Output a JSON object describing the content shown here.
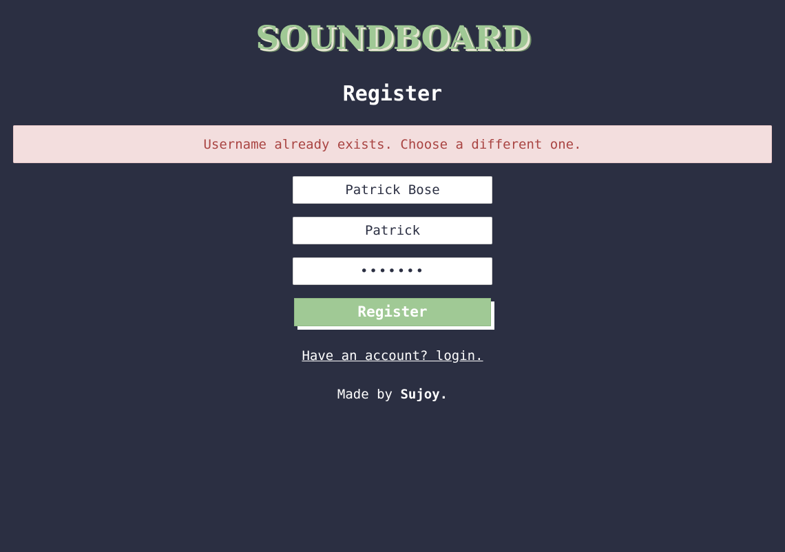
{
  "app": {
    "logo_text": "SOUNDBOARD"
  },
  "page": {
    "title": "Register"
  },
  "alert": {
    "message": "Username already exists. Choose a different one."
  },
  "form": {
    "name_value": "Patrick Bose",
    "username_value": "Patrick",
    "password_value": "•••••••",
    "submit_label": "Register"
  },
  "links": {
    "login_text": "Have an account? login."
  },
  "footer": {
    "prefix": "Made by ",
    "author": "Sujoy."
  },
  "colors": {
    "background": "#2b2f42",
    "accent_green": "#a0c995",
    "alert_bg": "#f3dede",
    "alert_text": "#a94442"
  }
}
